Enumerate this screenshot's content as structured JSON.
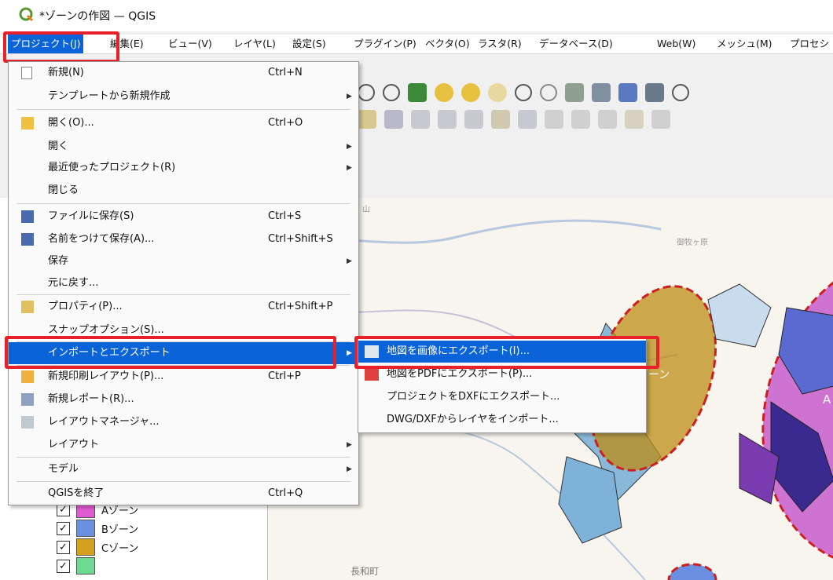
{
  "window": {
    "title": "*ゾーンの作図 — QGIS"
  },
  "menubar": {
    "items": [
      "プロジェクト(J)",
      "編集(E)",
      "ビュー(V)",
      "レイヤ(L)",
      "設定(S)",
      "プラグイン(P)",
      "ベクタ(O)",
      "ラスタ(R)",
      "データベース(D)",
      "Web(W)",
      "メッシュ(M)",
      "プロセシ"
    ]
  },
  "project_menu": {
    "items": [
      {
        "label": "新規(N)",
        "shortcut": "Ctrl+N"
      },
      {
        "label": "テンプレートから新規作成",
        "shortcut": ""
      },
      {
        "label": "開く(O)...",
        "shortcut": "Ctrl+O"
      },
      {
        "label": "開く",
        "shortcut": ""
      },
      {
        "label": "最近使ったプロジェクト(R)",
        "shortcut": ""
      },
      {
        "label": "閉じる",
        "shortcut": ""
      },
      {
        "label": "ファイルに保存(S)",
        "shortcut": "Ctrl+S"
      },
      {
        "label": "名前をつけて保存(A)...",
        "shortcut": "Ctrl+Shift+S"
      },
      {
        "label": "保存",
        "shortcut": ""
      },
      {
        "label": "元に戻す...",
        "shortcut": ""
      },
      {
        "label": "プロパティ(P)...",
        "shortcut": "Ctrl+Shift+P"
      },
      {
        "label": "スナップオプション(S)...",
        "shortcut": ""
      },
      {
        "label": "インポートとエクスポート",
        "shortcut": ""
      },
      {
        "label": "新規印刷レイアウト(P)...",
        "shortcut": "Ctrl+P"
      },
      {
        "label": "新規レポート(R)...",
        "shortcut": ""
      },
      {
        "label": "レイアウトマネージャ...",
        "shortcut": ""
      },
      {
        "label": "レイアウト",
        "shortcut": ""
      },
      {
        "label": "モデル",
        "shortcut": ""
      },
      {
        "label": "QGISを終了",
        "shortcut": "Ctrl+Q"
      }
    ]
  },
  "import_export_submenu": {
    "items": [
      "地図を画像にエクスポート(I)...",
      "地図をPDFにエクスポート(P)...",
      "プロジェクトをDXFにエクスポート...",
      "DWG/DXFからレイヤをインポート..."
    ]
  },
  "layers": [
    {
      "label": "Aゾーン",
      "color": "#e05ad0"
    },
    {
      "label": "Bゾーン",
      "color": "#6a8fe0"
    },
    {
      "label": "Cゾーン",
      "color": "#d4a020"
    },
    {
      "label": "",
      "color": "#6cd890"
    }
  ],
  "map": {
    "labels": [
      "ゾーン",
      "A",
      "長和町",
      "山",
      "御牧ヶ原"
    ]
  },
  "colors": {
    "highlight": "#0a64d8",
    "callout": "#e8202a"
  }
}
